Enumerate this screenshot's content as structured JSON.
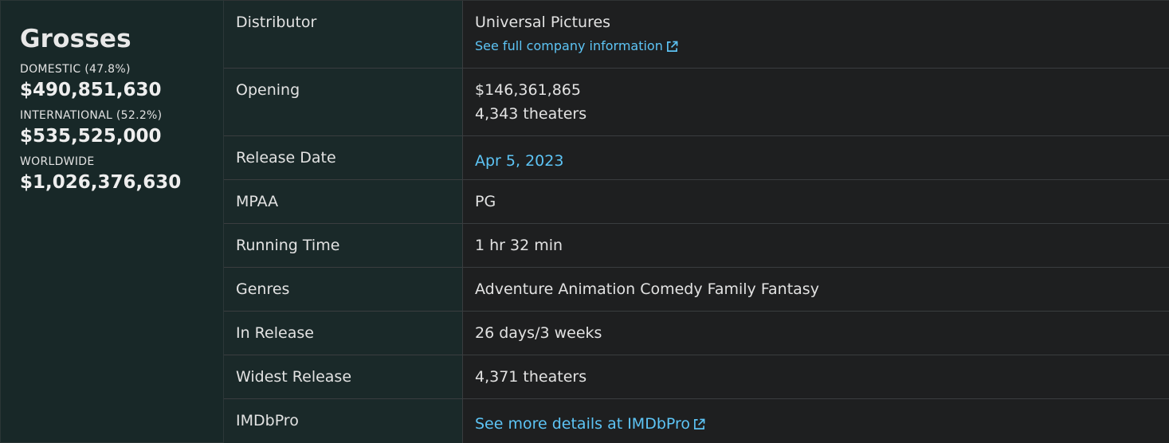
{
  "grosses": {
    "title": "Grosses",
    "domestic_label": "DOMESTIC (47.8%)",
    "domestic_value": "$490,851,630",
    "international_label": "INTERNATIONAL (52.2%)",
    "international_value": "$535,525,000",
    "worldwide_label": "WORLDWIDE",
    "worldwide_value": "$1,026,376,630"
  },
  "details": {
    "distributor_label": "Distributor",
    "distributor_value": "Universal Pictures",
    "distributor_link": "See full company information",
    "opening_label": "Opening",
    "opening_amount": "$146,361,865",
    "opening_theaters": "4,343 theaters",
    "release_date_label": "Release Date",
    "release_date_value": "Apr 5, 2023",
    "mpaa_label": "MPAA",
    "mpaa_value": "PG",
    "running_time_label": "Running Time",
    "running_time_value": "1 hr 32 min",
    "genres_label": "Genres",
    "genres_value": "Adventure Animation Comedy Family Fantasy",
    "in_release_label": "In Release",
    "in_release_value": "26 days/3 weeks",
    "widest_release_label": "Widest Release",
    "widest_release_value": "4,371 theaters",
    "imdbpro_label": "IMDbPro",
    "imdbpro_link": "See more details at IMDbPro"
  },
  "colors": {
    "link": "#5dc4f5",
    "panel": "#182828",
    "value_cell": "#1e1f20"
  }
}
